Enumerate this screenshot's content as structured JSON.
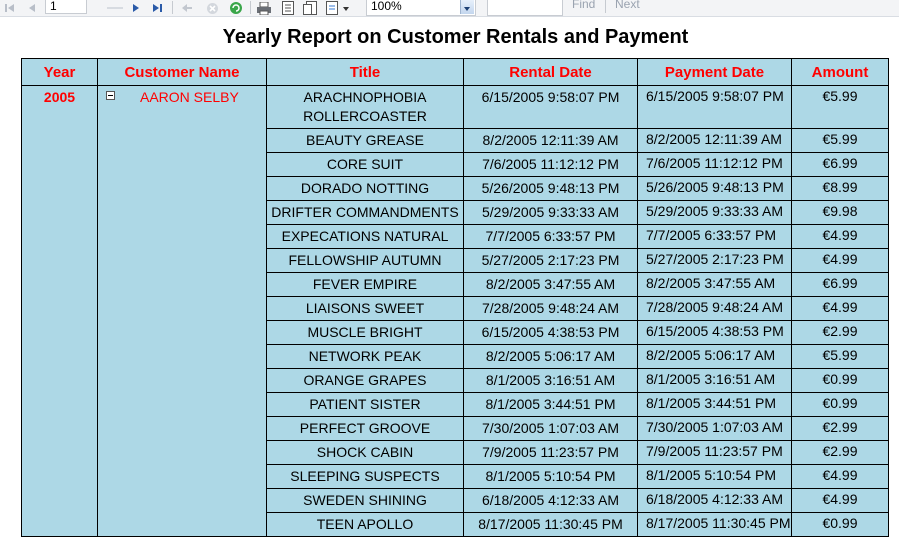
{
  "toolbar": {
    "page_value": "1",
    "zoom_value": "100%",
    "find_label": "Find",
    "next_label": "Next"
  },
  "report": {
    "title": "Yearly Report on Customer Rentals and Payment",
    "headers": {
      "year": "Year",
      "customer": "Customer Name",
      "title": "Title",
      "rental": "Rental Date",
      "payment": "Payment Date",
      "amount": "Amount"
    },
    "year": "2005",
    "customer_name": "AARON SELBY",
    "rows": [
      {
        "title": "ARACHNOPHOBIA ROLLERCOASTER",
        "rental": "6/15/2005 9:58:07 PM",
        "payment": "6/15/2005 9:58:07 PM",
        "amount": "€5.99"
      },
      {
        "title": "BEAUTY GREASE",
        "rental": "8/2/2005 12:11:39 AM",
        "payment": "8/2/2005 12:11:39 AM",
        "amount": "€5.99"
      },
      {
        "title": "CORE SUIT",
        "rental": "7/6/2005 11:12:12 PM",
        "payment": "7/6/2005 11:12:12 PM",
        "amount": "€6.99"
      },
      {
        "title": "DORADO NOTTING",
        "rental": "5/26/2005 9:48:13 PM",
        "payment": "5/26/2005 9:48:13 PM",
        "amount": "€8.99"
      },
      {
        "title": "DRIFTER COMMANDMENTS",
        "rental": "5/29/2005 9:33:33 AM",
        "payment": "5/29/2005 9:33:33 AM",
        "amount": "€9.98"
      },
      {
        "title": "EXPECATIONS NATURAL",
        "rental": "7/7/2005 6:33:57 PM",
        "payment": "7/7/2005 6:33:57 PM",
        "amount": "€4.99"
      },
      {
        "title": "FELLOWSHIP AUTUMN",
        "rental": "5/27/2005 2:17:23 PM",
        "payment": "5/27/2005 2:17:23 PM",
        "amount": "€4.99"
      },
      {
        "title": "FEVER EMPIRE",
        "rental": "8/2/2005 3:47:55 AM",
        "payment": "8/2/2005 3:47:55 AM",
        "amount": "€6.99"
      },
      {
        "title": "LIAISONS SWEET",
        "rental": "7/28/2005 9:48:24 AM",
        "payment": "7/28/2005 9:48:24 AM",
        "amount": "€4.99"
      },
      {
        "title": "MUSCLE BRIGHT",
        "rental": "6/15/2005 4:38:53 PM",
        "payment": "6/15/2005 4:38:53 PM",
        "amount": "€2.99"
      },
      {
        "title": "NETWORK PEAK",
        "rental": "8/2/2005 5:06:17 AM",
        "payment": "8/2/2005 5:06:17 AM",
        "amount": "€5.99"
      },
      {
        "title": "ORANGE GRAPES",
        "rental": "8/1/2005 3:16:51 AM",
        "payment": "8/1/2005 3:16:51 AM",
        "amount": "€0.99"
      },
      {
        "title": "PATIENT SISTER",
        "rental": "8/1/2005 3:44:51 PM",
        "payment": "8/1/2005 3:44:51 PM",
        "amount": "€0.99"
      },
      {
        "title": "PERFECT GROOVE",
        "rental": "7/30/2005 1:07:03 AM",
        "payment": "7/30/2005 1:07:03 AM",
        "amount": "€2.99"
      },
      {
        "title": "SHOCK CABIN",
        "rental": "7/9/2005 11:23:57 PM",
        "payment": "7/9/2005 11:23:57 PM",
        "amount": "€2.99"
      },
      {
        "title": "SLEEPING SUSPECTS",
        "rental": "8/1/2005 5:10:54 PM",
        "payment": "8/1/2005 5:10:54 PM",
        "amount": "€4.99"
      },
      {
        "title": "SWEDEN SHINING",
        "rental": "6/18/2005 4:12:33 AM",
        "payment": "6/18/2005 4:12:33 AM",
        "amount": "€4.99"
      },
      {
        "title": "TEEN APOLLO",
        "rental": "8/17/2005 11:30:45 PM",
        "payment": "8/17/2005 11:30:45 PM",
        "amount": "€0.99"
      }
    ]
  }
}
